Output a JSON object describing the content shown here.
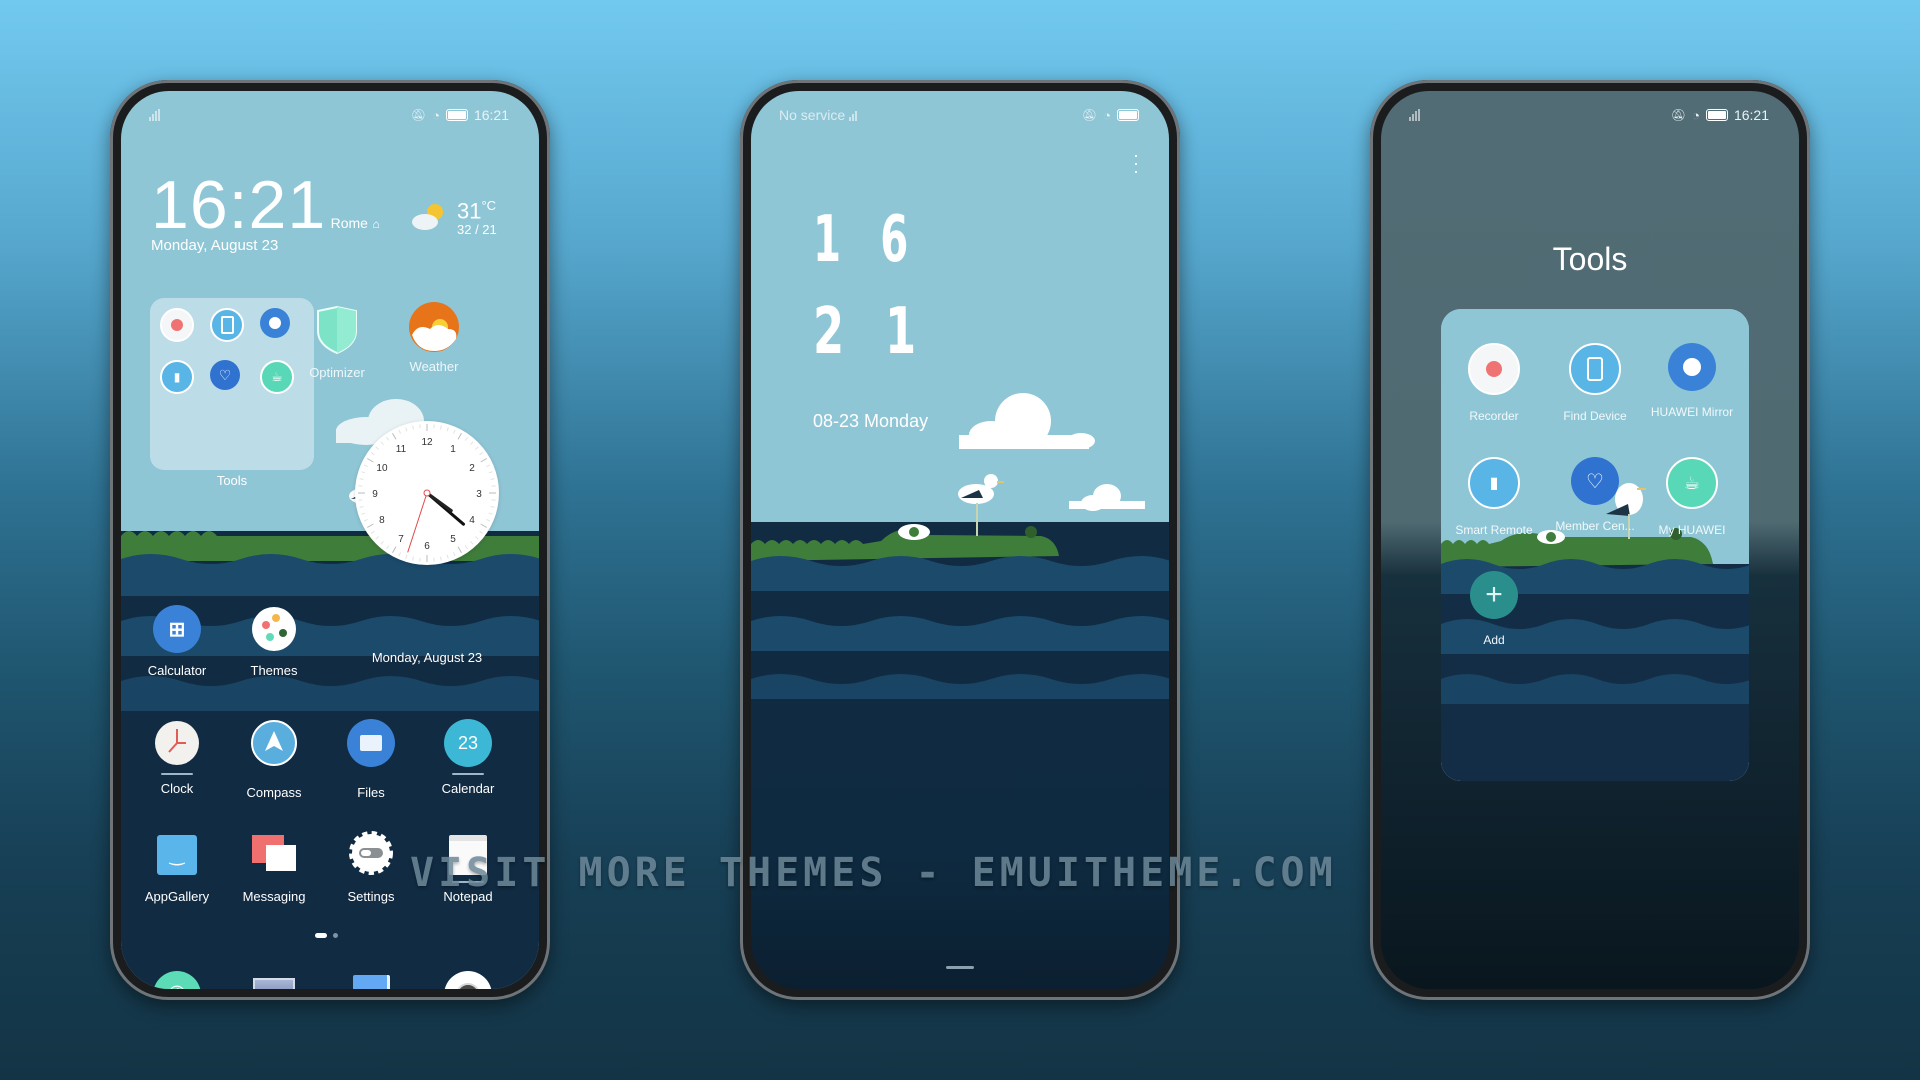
{
  "watermark": "VISIT MORE THEMES - EMUITHEME.COM",
  "colors": {
    "sky": "#8fc6d6",
    "wave_dark": "#122d45",
    "wave_mid": "#1b4a6b",
    "grass": "#3f7d3b",
    "tools_overlay": "#516c74",
    "accent_blue": "#3a82d8",
    "accent_teal": "#59d8b8"
  },
  "home_screen": {
    "status": {
      "time": "16:21"
    },
    "clock_widget": {
      "time": "16:21",
      "city": "Rome",
      "date": "Monday, August 23"
    },
    "weather_widget": {
      "temp": "31",
      "unit": "°C",
      "range": "32 / 21"
    },
    "folder": {
      "label": "Tools"
    },
    "apps": [
      {
        "label": "Optimizer"
      },
      {
        "label": "Weather"
      },
      {
        "label": "Calculator"
      },
      {
        "label": "Themes"
      },
      {
        "label": "Clock"
      },
      {
        "label": "Compass"
      },
      {
        "label": "Files"
      },
      {
        "label": "Calendar",
        "badge": "23"
      },
      {
        "label": "AppGallery"
      },
      {
        "label": "Messaging"
      },
      {
        "label": "Settings"
      },
      {
        "label": "Notepad"
      }
    ],
    "analog_clock": {
      "date": "Monday, August 23",
      "numbers": [
        "12",
        "1",
        "2",
        "3",
        "4",
        "5",
        "6",
        "7",
        "8",
        "9",
        "10",
        "11"
      ]
    },
    "page_indicator": {
      "pages": 2,
      "current": 1
    },
    "dock": [
      {
        "name": "Phone"
      },
      {
        "name": "Gallery"
      },
      {
        "name": "Notes"
      },
      {
        "name": "Camera"
      }
    ]
  },
  "lock_screen": {
    "status": {
      "carrier": "No service"
    },
    "time_top": "1 6",
    "time_bottom": "2 1",
    "date": "08-23 Monday"
  },
  "tools_folder": {
    "status": {
      "time": "16:21"
    },
    "title": "Tools",
    "apps": [
      {
        "label": "Recorder"
      },
      {
        "label": "Find Device"
      },
      {
        "label": "HUAWEI Mirror"
      },
      {
        "label": "Smart Remote"
      },
      {
        "label": "Member Cen..."
      },
      {
        "label": "My HUAWEI"
      },
      {
        "label": "Add"
      }
    ]
  }
}
